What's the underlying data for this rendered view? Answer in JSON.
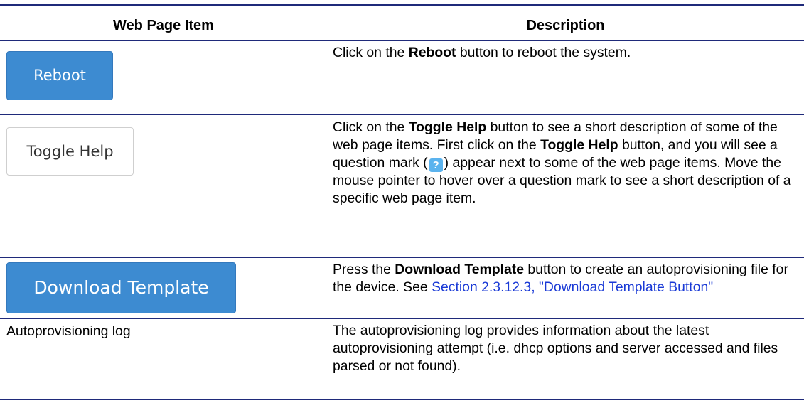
{
  "header": {
    "col1": "Web Page Item",
    "col2": "Description"
  },
  "rows": [
    {
      "item_label": "Reboot",
      "desc": {
        "p1": "Click on the ",
        "b1": "Reboot",
        "p2": " button to reboot the system."
      }
    },
    {
      "item_label": "Toggle Help",
      "desc": {
        "p1": "Click on the ",
        "b1": "Toggle Help",
        "p2": " button to see a short description of some of the web page items. First click on the ",
        "b2": "Toggle Help",
        "p3": " button, and you will see a question mark (",
        "qmark": "?",
        "p4": ") appear next to some of the web page items. Move the mouse pointer to hover over a question mark to see a short description of a specific web page item."
      }
    },
    {
      "item_label": "Download Template",
      "desc": {
        "p1": "Press the ",
        "b1": "Download Template",
        "p2": " button to create an autoprovisioning file for the device. See ",
        "link": "Section 2.3.12.3, \"Download Template Button\""
      }
    },
    {
      "item_label": "Autoprovisioning log",
      "desc": {
        "p1": "The autoprovisioning log provides information about the latest autoprovisioning attempt (i.e. dhcp options and server accessed and files parsed or not found)."
      }
    }
  ],
  "colors": {
    "rule": "#1f2a7a",
    "button_blue": "#3d8bd1",
    "link": "#1a3ad6",
    "qmark": "#5bb3ee"
  }
}
